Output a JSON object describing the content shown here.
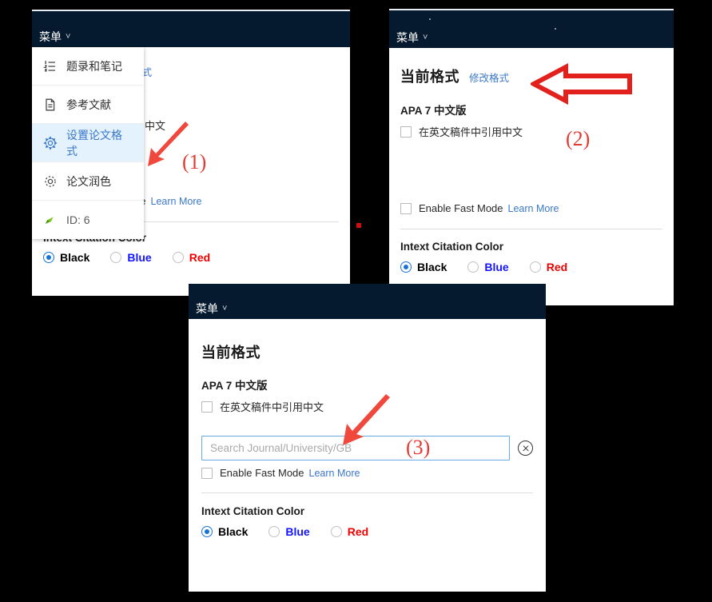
{
  "app": {
    "menu_button_label": "菜单",
    "menu_chevron": "chevron-down-icon"
  },
  "dropdown": {
    "items": [
      {
        "label": "题录和笔记",
        "icon": "list-icon",
        "active": false
      },
      {
        "label": "参考文献",
        "icon": "document-icon",
        "active": false
      },
      {
        "label": "设置论文格式",
        "icon": "gear-icon",
        "active": true
      },
      {
        "label": "论文润色",
        "icon": "gear-icon",
        "active": false
      },
      {
        "label": "ID: 6",
        "icon": "flag-icon",
        "active": false
      }
    ]
  },
  "format_panel": {
    "heading": "当前格式",
    "edit_link": "修改格式",
    "style_name": "APA 7 中文版",
    "cite_chinese_checkbox_label": "在英文稿件中引用中文",
    "search_placeholder": "Search Journal/University/GB",
    "search_value": "",
    "clear_icon": "clear-circle-x-icon",
    "fast_mode_label": "Enable Fast Mode",
    "learn_more_label": "Learn More",
    "citation_color_title": "Intext Citation Color",
    "citation_color_options": [
      {
        "label": "Black",
        "color": "#000000",
        "selected": true
      },
      {
        "label": "Blue",
        "color": "#1414ff",
        "selected": false
      },
      {
        "label": "Red",
        "color": "#ee0000",
        "selected": false
      }
    ]
  },
  "annotations": [
    {
      "label": "(1)"
    },
    {
      "label": "(2)"
    },
    {
      "label": "(3)"
    }
  ],
  "colors": {
    "appbar": "#051a2e",
    "accent_link": "#3b78c8",
    "annotation_red": "#e23b33",
    "arrow_solid": "#f0483c",
    "arrow_outline": "#e2201c",
    "input_border": "#6aaae4",
    "active_item_bg": "#e3f2fd"
  }
}
